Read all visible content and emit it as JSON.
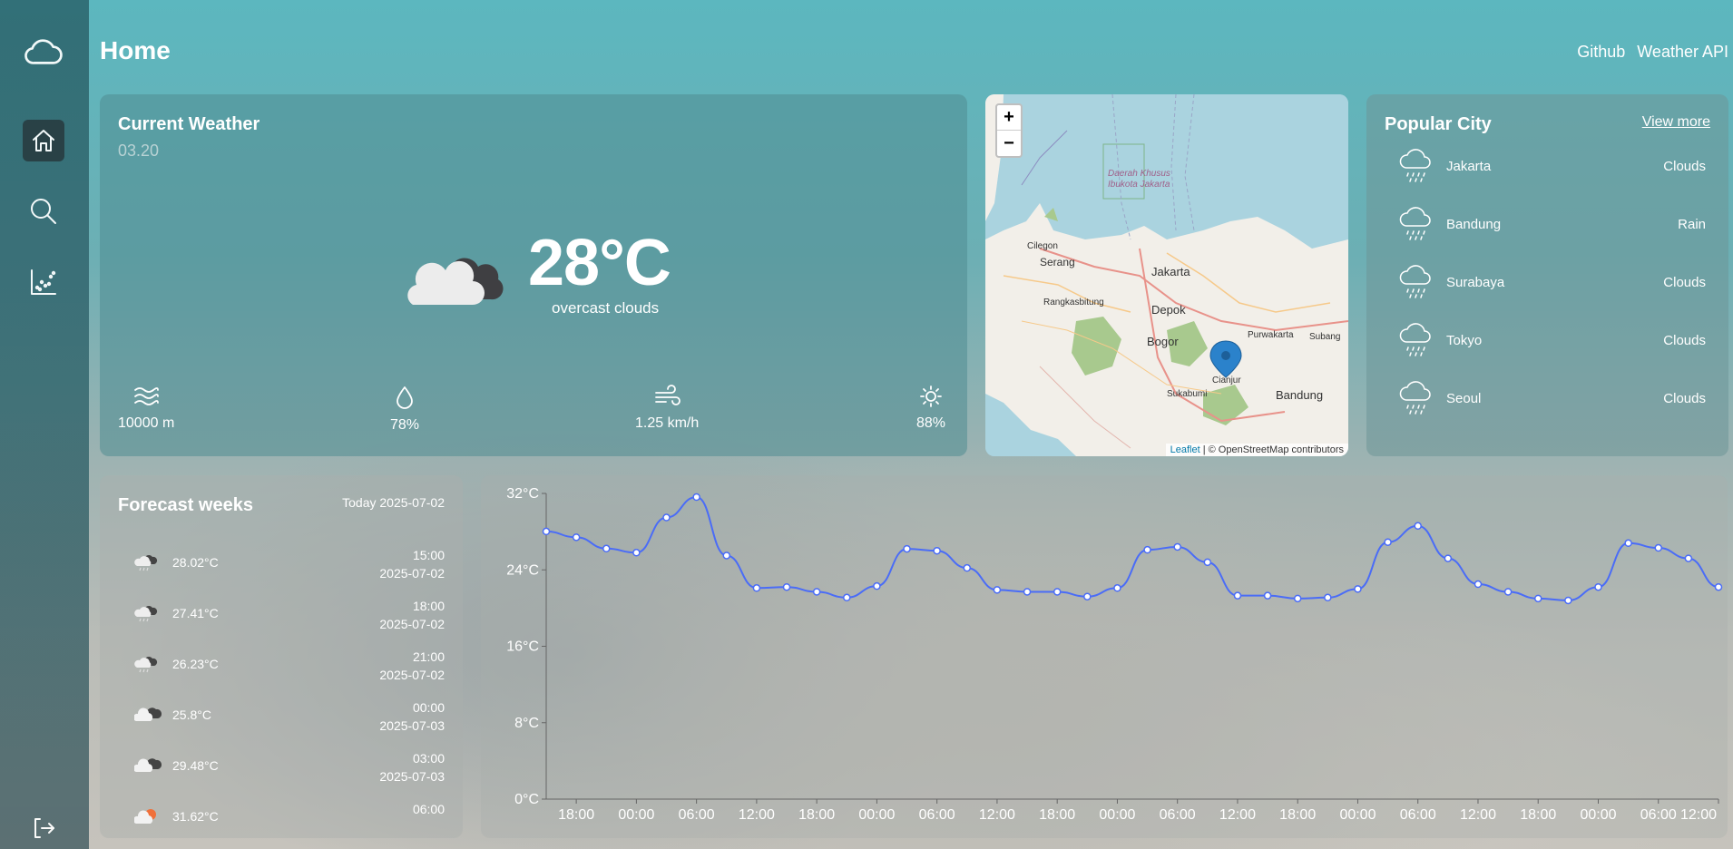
{
  "header": {
    "title": "Home",
    "links": [
      "Github",
      "Weather API"
    ]
  },
  "sidebar": {
    "items": [
      "cloud-logo-icon",
      "home-icon",
      "search-icon",
      "chart-icon"
    ],
    "logout": "logout-icon"
  },
  "current_weather": {
    "title": "Current Weather",
    "time": "03.20",
    "temperature": "28°C",
    "description": "overcast clouds",
    "icon": "overcast-clouds-icon",
    "stats": {
      "visibility": "10000 m",
      "humidity": "78%",
      "wind": "1.25 km/h",
      "clouds": "88%"
    }
  },
  "map": {
    "zoom_in": "+",
    "zoom_out": "−",
    "labels": [
      "Daerah Khusus",
      "Ibukota Jakarta",
      "Cilegon",
      "Serang",
      "Jakarta",
      "Rangkasbitung",
      "Depok",
      "Bogor",
      "Purwakarta",
      "Subang",
      "Cianjur",
      "Sukabumi",
      "Bandung"
    ],
    "attribution_link": "Leaflet",
    "attribution_text": " | © OpenStreetMap contributors"
  },
  "popular_city": {
    "title": "Popular City",
    "view_more": "View more",
    "cities": [
      {
        "name": "Jakarta",
        "condition": "Clouds"
      },
      {
        "name": "Bandung",
        "condition": "Rain"
      },
      {
        "name": "Surabaya",
        "condition": "Clouds"
      },
      {
        "name": "Tokyo",
        "condition": "Clouds"
      },
      {
        "name": "Seoul",
        "condition": "Clouds"
      }
    ]
  },
  "forecast": {
    "title": "Forecast weeks",
    "today": "Today 2025-07-02",
    "rows": [
      {
        "temp": "28.02°C",
        "time": "15:00",
        "date": "2025-07-02",
        "icon": "rain-cloud-icon"
      },
      {
        "temp": "27.41°C",
        "time": "18:00",
        "date": "2025-07-02",
        "icon": "rain-cloud-icon"
      },
      {
        "temp": "26.23°C",
        "time": "21:00",
        "date": "2025-07-02",
        "icon": "rain-cloud-icon"
      },
      {
        "temp": "25.8°C",
        "time": "00:00",
        "date": "2025-07-03",
        "icon": "clouds-icon"
      },
      {
        "temp": "29.48°C",
        "time": "03:00",
        "date": "2025-07-03",
        "icon": "clouds-icon"
      },
      {
        "temp": "31.62°C",
        "time": "06:00",
        "date": "",
        "icon": "sun-cloud-icon"
      }
    ]
  },
  "chart_data": {
    "type": "line",
    "ylabel_unit": "°C",
    "ylim": [
      0,
      32
    ],
    "yticks": [
      "0°C",
      "8°C",
      "16°C",
      "24°C",
      "32°C"
    ],
    "xticks": [
      "18:00",
      "00:00",
      "06:00",
      "12:00",
      "18:00",
      "00:00",
      "06:00",
      "12:00",
      "18:00",
      "00:00",
      "06:00",
      "12:00",
      "18:00",
      "00:00",
      "06:00",
      "12:00",
      "18:00",
      "00:00",
      "06:00",
      "12:00"
    ],
    "grid": false,
    "color": "#4a6cf7",
    "series": [
      {
        "values": [
          28.02,
          27.41,
          26.23,
          25.8,
          29.48,
          31.62,
          25.5,
          22.1,
          22.2,
          21.7,
          21.1,
          22.3,
          26.2,
          26.0,
          24.2,
          21.9,
          21.7,
          21.7,
          21.2,
          22.1,
          26.1,
          26.4,
          24.8,
          21.3,
          21.3,
          21.0,
          21.1,
          22.0,
          26.9,
          28.6,
          25.2,
          22.5,
          21.7,
          21.0,
          20.8,
          22.2,
          26.8,
          26.3,
          25.2,
          22.2
        ]
      }
    ]
  }
}
